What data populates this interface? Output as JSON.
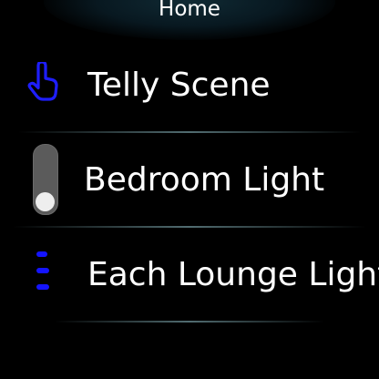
{
  "header": {
    "title": "Home"
  },
  "items": [
    {
      "label": "Telly Scene",
      "icon": "touch-hand-icon",
      "type": "scene"
    },
    {
      "label": "Bedroom Light",
      "icon": "toggle-icon",
      "type": "toggle",
      "state": "off"
    },
    {
      "label": "Each Lounge Light",
      "icon": "light-group-icon",
      "type": "group"
    }
  ],
  "colors": {
    "background": "#000000",
    "accent_blue": "#1414ff",
    "toggle_track": "#5b5b5b",
    "toggle_knob": "#eeeeee",
    "divider": "#5a787d"
  }
}
